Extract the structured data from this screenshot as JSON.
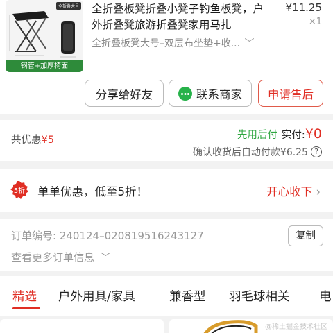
{
  "product": {
    "thumb_tag": "全折叠大号",
    "thumb_strip": "钢管+加厚椅面",
    "title": "全折叠板凳折叠小凳子钓鱼板凳，户外折叠凳旅游折叠凳家用马扎",
    "price": "¥11.25",
    "qty": "×1",
    "spec": "全折叠板凳大号–双层布坐垫+收...",
    "buttons": {
      "share": "分享给好友",
      "contact": "联系商家",
      "refund": "申请售后"
    }
  },
  "payment": {
    "discount_label": "共优惠",
    "discount_value": "¥5",
    "pay_later": "先用后付",
    "actual_label": "实付:",
    "actual_value": "¥0",
    "confirm_text": "确认收货后自动付款¥6.25"
  },
  "promo": {
    "badge_text": "5折",
    "text": "单单优惠，低至5折！",
    "link": "开心收下"
  },
  "order": {
    "number_label": "订单编号:",
    "number_value": "240124–020819516243127",
    "copy_label": "复制",
    "more_label": "查看更多订单信息"
  },
  "tabs": [
    "精选",
    "户外用具/家具",
    "兼香型",
    "羽毛球相关",
    "电"
  ],
  "watermark": "@稀土掘金技术社区",
  "colors": {
    "accent": "#e02e24",
    "green": "#2fa640"
  }
}
